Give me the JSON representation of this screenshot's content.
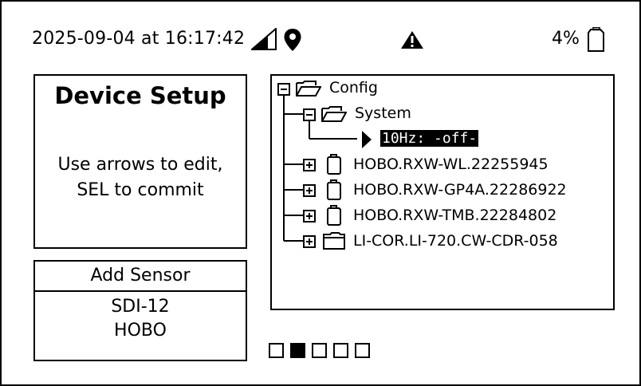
{
  "status": {
    "datetime": "2025-09-04 at 16:17:42",
    "battery_percent": "4%"
  },
  "icons": {
    "signal": "signal-strength-icon",
    "location": "location-pin-icon",
    "warning": "warning-triangle-icon",
    "battery": "battery-icon"
  },
  "setup": {
    "title": "Device Setup",
    "instruction_line1": "Use arrows to edit,",
    "instruction_line2": "SEL to commit"
  },
  "add_sensor": {
    "header": "Add Sensor",
    "options": [
      "SDI-12",
      "HOBO"
    ]
  },
  "tree": {
    "root": "Config",
    "system": "System",
    "selected_setting": "10Hz: -off-",
    "devices": [
      "HOBO.RXW-WL.22255945",
      "HOBO.RXW-GP4A.22286922",
      "HOBO.RXW-TMB.22284802",
      "LI-COR.LI-720.CW-CDR-058"
    ]
  },
  "pagination": {
    "total_pages": 5,
    "current_page": 2
  }
}
